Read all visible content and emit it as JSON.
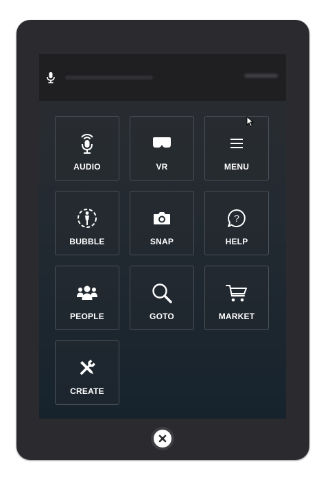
{
  "topbar": {
    "mic_icon": "microphone-icon",
    "mic_level": 0,
    "username": "•••••••••••"
  },
  "tiles": [
    {
      "label": "AUDIO",
      "icon": "microphone-icon"
    },
    {
      "label": "VR",
      "icon": "vr-headset-icon"
    },
    {
      "label": "MENU",
      "icon": "hamburger-menu-icon"
    },
    {
      "label": "BUBBLE",
      "icon": "bubble-icon"
    },
    {
      "label": "SNAP",
      "icon": "camera-icon"
    },
    {
      "label": "HELP",
      "icon": "help-icon"
    },
    {
      "label": "PEOPLE",
      "icon": "people-icon"
    },
    {
      "label": "GOTO",
      "icon": "search-icon"
    },
    {
      "label": "MARKET",
      "icon": "cart-icon"
    },
    {
      "label": "CREATE",
      "icon": "create-tools-icon"
    }
  ],
  "close_button": {
    "icon": "close-icon"
  },
  "colors": {
    "tablet_frame": "#2b2b2f",
    "screen_top": "#2b2d31",
    "screen_bottom": "#16232d",
    "tile_border": "#4a5057",
    "text": "#ffffff"
  }
}
